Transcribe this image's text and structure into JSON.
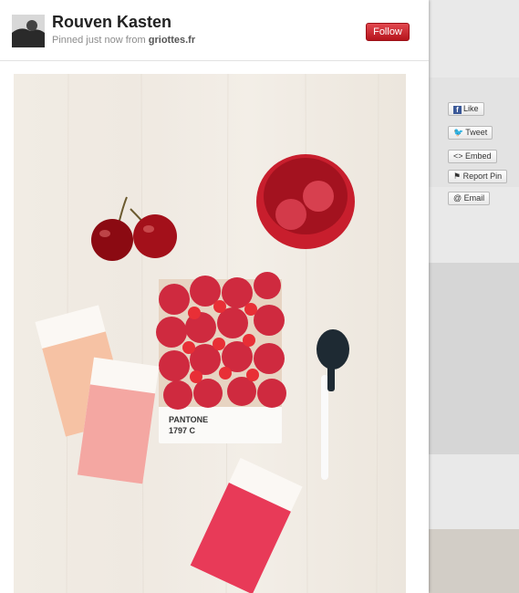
{
  "pin": {
    "user_name": "Rouven Kasten",
    "pinned_prefix": "Pinned just now from",
    "source": "griottes.fr",
    "follow_label": "Follow"
  },
  "photo": {
    "swatch_label_line1": "PANTONE",
    "swatch_label_line2": "1797 C"
  },
  "share": {
    "like_label": "Like",
    "tweet_label": "Tweet",
    "embed_label": "<> Embed",
    "report_label": "Report Pin",
    "email_label": "@ Email"
  },
  "colors": {
    "follow_red": "#cb2027",
    "raspberry": "#d8283a",
    "pink_swatch": "#f4a7a2"
  }
}
